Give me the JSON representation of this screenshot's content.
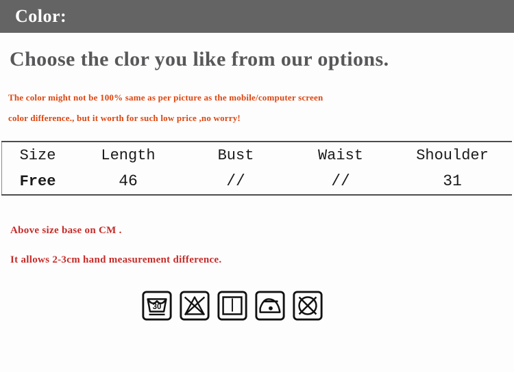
{
  "header": {
    "title": "Color:",
    "bar_color": "#646464",
    "text_color": "#ffffff"
  },
  "headline": {
    "text": "Choose the clor you like from our options.",
    "color": "#58585a"
  },
  "disclaimer": {
    "color": "#dd450f",
    "lines": [
      "The color might not be 100% same as per picture as  the  mobile/computer screen",
      "color difference., but it worth for such low price ,no worry!"
    ]
  },
  "size_table": {
    "columns": [
      "Size",
      "Length",
      "Bust",
      "Waist",
      "Shoulder"
    ],
    "rows": [
      {
        "size": "Free",
        "length": "46",
        "bust": "//",
        "waist": "//",
        "shoulder": "31"
      }
    ]
  },
  "notes": {
    "color": "#c62b28",
    "lines": [
      "Above size base on CM .",
      "It allows 2-3cm hand measurement difference."
    ]
  },
  "care_icons": [
    {
      "name": "wash-30-gentle-icon",
      "label": "Machine wash 30C gentle",
      "value": "30"
    },
    {
      "name": "do-not-bleach-icon",
      "label": "Do not bleach",
      "value": ""
    },
    {
      "name": "drip-dry-icon",
      "label": "Drip dry / line dry",
      "value": ""
    },
    {
      "name": "iron-low-icon",
      "label": "Iron low temperature",
      "value": ""
    },
    {
      "name": "do-not-tumble-dry-icon",
      "label": "Do not tumble dry",
      "value": ""
    }
  ]
}
